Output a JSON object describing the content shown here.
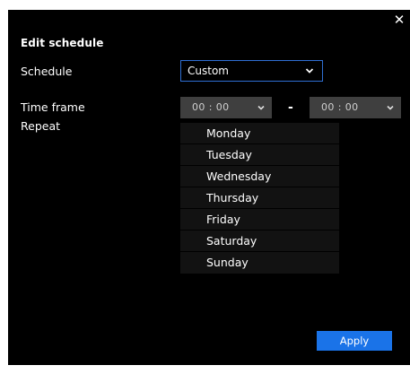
{
  "dialog": {
    "title": "Edit schedule",
    "close_icon": "close-icon",
    "schedule_label": "Schedule",
    "time_frame_label": "Time frame",
    "repeat_label": "Repeat",
    "schedule_value": "Custom",
    "start_time": "00 : 00",
    "end_time": "00 : 00",
    "separator": "-",
    "days": [
      "Monday",
      "Tuesday",
      "Wednesday",
      "Thursday",
      "Friday",
      "Saturday",
      "Sunday"
    ],
    "apply_label": "Apply"
  },
  "colors": {
    "background": "#000000",
    "accent": "#1a73e8",
    "select_border": "#2f6fd3",
    "time_select_bg": "#3f3f3f",
    "list_bg": "#121212"
  }
}
